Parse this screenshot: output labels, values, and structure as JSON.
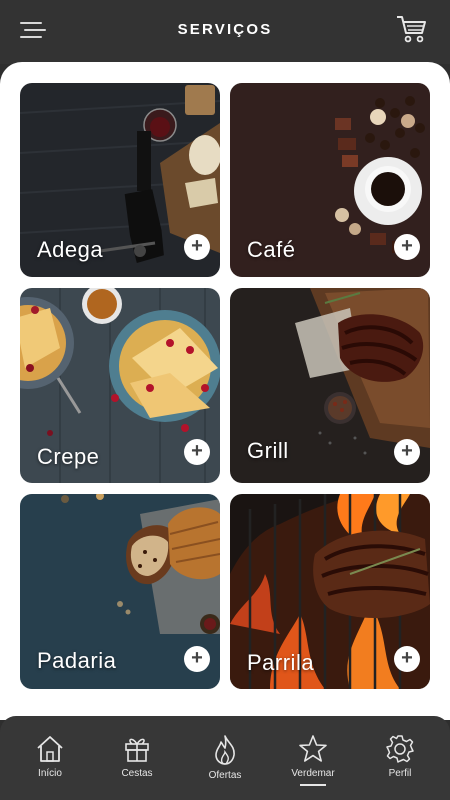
{
  "header": {
    "title": "SERVIÇOS",
    "menu_icon": "hamburger-menu-icon",
    "cart_icon": "shopping-cart-icon"
  },
  "services": [
    {
      "id": "adega",
      "label": "Adega",
      "photo": "wine-bottle-photo"
    },
    {
      "id": "cafe",
      "label": "Café",
      "photo": "coffee-cup-photo"
    },
    {
      "id": "crepe",
      "label": "Crepe",
      "photo": "crepes-plate-photo"
    },
    {
      "id": "grill",
      "label": "Grill",
      "photo": "grilled-steak-board-photo"
    },
    {
      "id": "padaria",
      "label": "Padaria",
      "photo": "bread-loaf-photo"
    },
    {
      "id": "parrila",
      "label": "Parrila",
      "photo": "steak-on-fire-grill-photo"
    }
  ],
  "add_icon": "plus-icon",
  "nav": {
    "items": [
      {
        "label": "Início",
        "icon": "home-icon"
      },
      {
        "label": "Cestas",
        "icon": "gift-icon"
      },
      {
        "label": "Ofertas",
        "icon": "flame-icon"
      },
      {
        "label": "Verdemar",
        "icon": "star-icon",
        "active": true
      },
      {
        "label": "Perfil",
        "icon": "gear-icon"
      }
    ]
  },
  "colors": {
    "header_bg": "#333333",
    "content_bg": "#ffffff",
    "nav_bg": "#373737",
    "text_light": "#ffffff"
  }
}
